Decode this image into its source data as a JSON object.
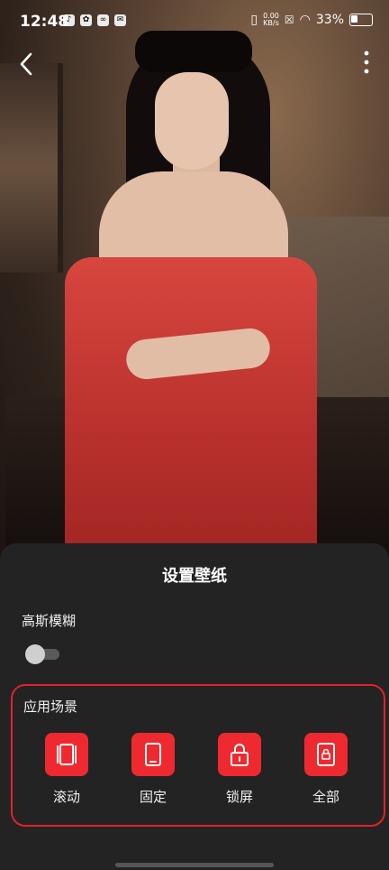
{
  "status": {
    "time": "12:48",
    "net_speed_value": "0.00",
    "net_speed_unit": "KB/s",
    "battery": "33%"
  },
  "sheet": {
    "title": "设置壁纸",
    "blur_label": "高斯模糊",
    "blur_enabled": false,
    "scene_label": "应用场景",
    "scenes": [
      {
        "label": "滚动",
        "icon": "scroll-phone-icon"
      },
      {
        "label": "固定",
        "icon": "phone-icon"
      },
      {
        "label": "锁屏",
        "icon": "lock-icon"
      },
      {
        "label": "全部",
        "icon": "phone-lock-icon"
      }
    ]
  },
  "colors": {
    "accent": "#EE2A30",
    "sheet_bg": "#232323"
  }
}
